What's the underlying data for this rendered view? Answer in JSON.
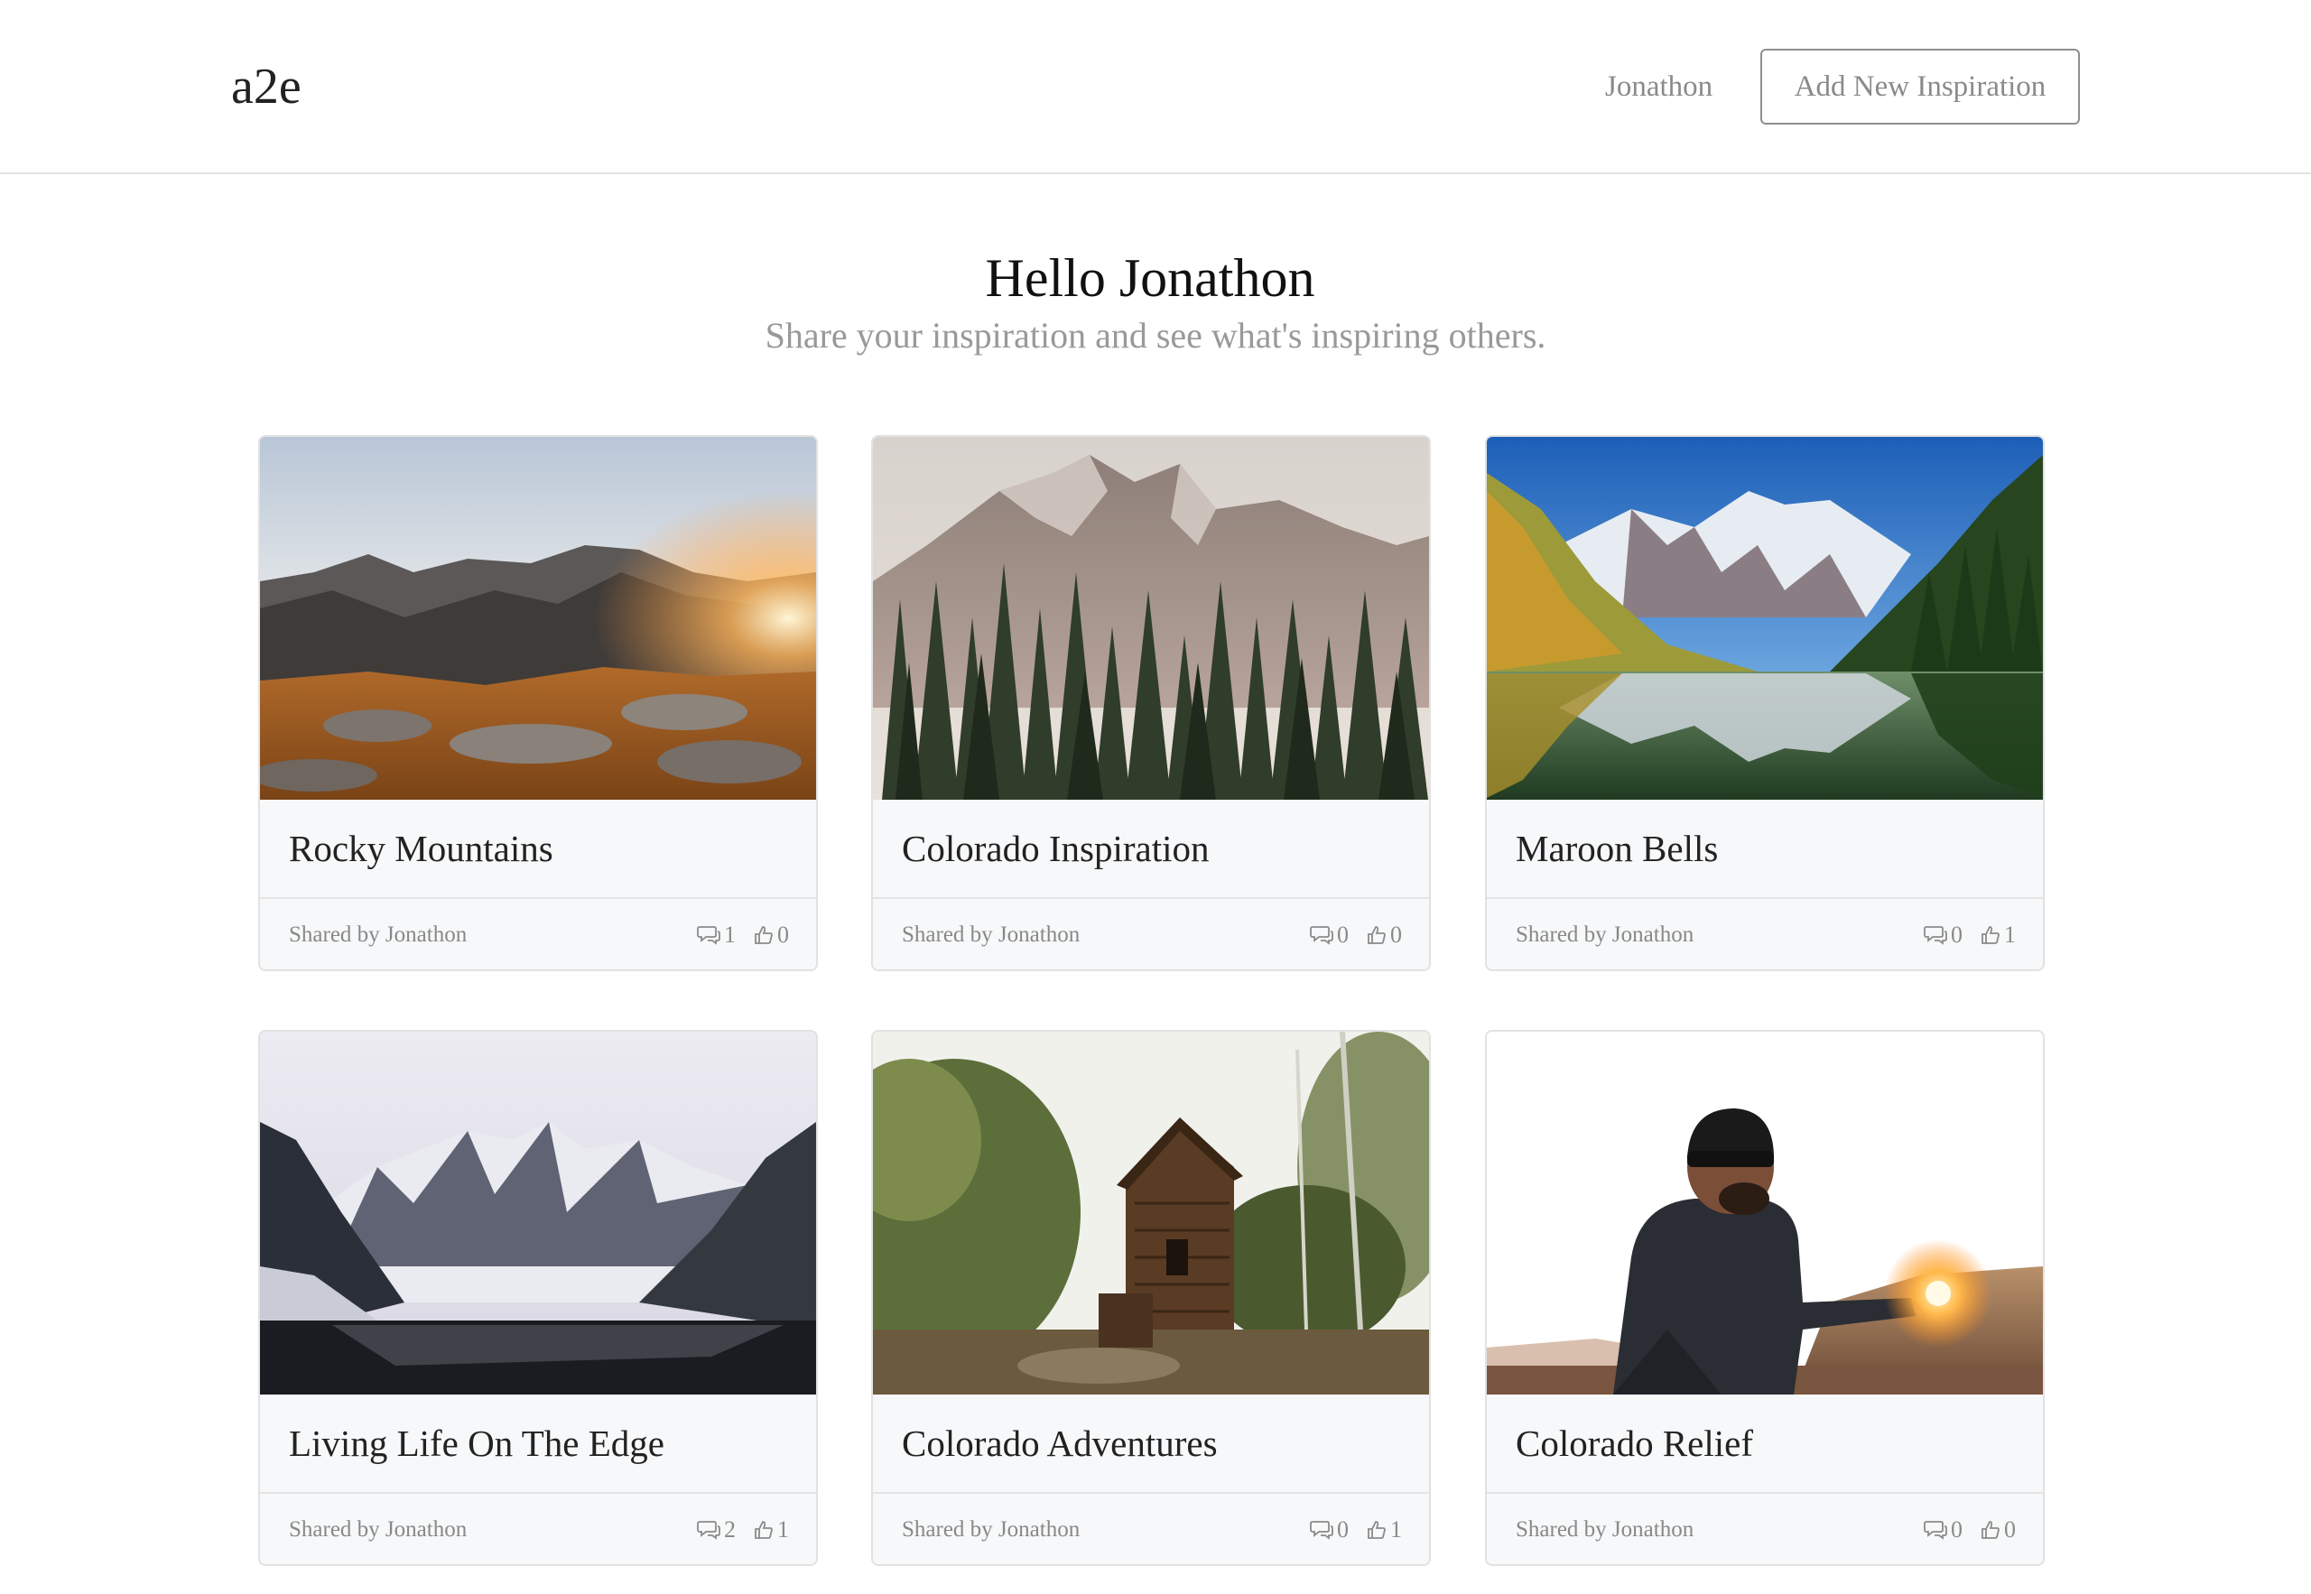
{
  "header": {
    "brand": "a2e",
    "user_name": "Jonathon",
    "add_button_label": "Add New Inspiration"
  },
  "hero": {
    "title": "Hello Jonathon",
    "subtitle": "Share your inspiration and see what's inspiring others."
  },
  "cards": [
    {
      "title": "Rocky Mountains",
      "author": "Shared by Jonathon",
      "comments": "1",
      "likes": "0",
      "image": "mountain ridge at sunset with golden grass"
    },
    {
      "title": "Colorado Inspiration",
      "author": "Shared by Jonathon",
      "comments": "0",
      "likes": "0",
      "image": "rocky peak above pine forest"
    },
    {
      "title": "Maroon Bells",
      "author": "Shared by Jonathon",
      "comments": "0",
      "likes": "1",
      "image": "snowy peaks reflected in alpine lake"
    },
    {
      "title": "Living Life On The Edge",
      "author": "Shared by Jonathon",
      "comments": "2",
      "likes": "1",
      "image": "snowy mountains over dark lake"
    },
    {
      "title": "Colorado Adventures",
      "author": "Shared by Jonathon",
      "comments": "0",
      "likes": "1",
      "image": "old wooden mill in forest"
    },
    {
      "title": "Colorado Relief",
      "author": "Shared by Jonathon",
      "comments": "0",
      "likes": "0",
      "image": "man in beanie holding sunset"
    }
  ],
  "icons": {
    "comment": "comment-icon",
    "like": "thumbs-up-icon"
  }
}
